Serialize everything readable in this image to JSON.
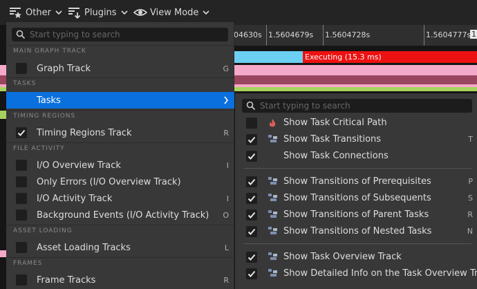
{
  "toolbar": {
    "other_label": "Other",
    "plugins_label": "Plugins",
    "view_mode_label": "View Mode"
  },
  "timeline": {
    "ticks": [
      "04630s",
      "1.5604679s",
      "1.5604728s",
      "1.5604777s",
      "1"
    ],
    "executing_label": "Executing (15.3 ms)"
  },
  "menu": {
    "search_placeholder": "Start typing to search",
    "sections": {
      "main_graph_track": "MAIN GRAPH TRACK",
      "tasks": "TASKS",
      "timing_regions": "TIMING REGIONS",
      "file_activity": "FILE ACTIVITY",
      "asset_loading": "ASSET LOADING",
      "frames": "FRAMES"
    },
    "items": {
      "graph_track": {
        "label": "Graph Track",
        "key": "G",
        "checked": false
      },
      "tasks": {
        "label": "Tasks"
      },
      "timing_regions_track": {
        "label": "Timing Regions Track",
        "key": "R",
        "checked": true
      },
      "io_overview_track": {
        "label": "I/O Overview Track",
        "key": "I",
        "checked": false
      },
      "only_errors": {
        "label": "Only Errors (I/O Overview Track)",
        "key": "",
        "checked": false
      },
      "io_activity_track": {
        "label": "I/O Activity Track",
        "key": "I",
        "checked": false
      },
      "background_events": {
        "label": "Background Events (I/O Activity Track)",
        "key": "O",
        "checked": false
      },
      "asset_loading_tracks": {
        "label": "Asset Loading Tracks",
        "key": "L",
        "checked": false
      },
      "frame_tracks": {
        "label": "Frame Tracks",
        "key": "R",
        "checked": false
      }
    }
  },
  "submenu": {
    "search_placeholder": "Start typing to search",
    "items": [
      {
        "label": "Show Task Critical Path",
        "key": "",
        "checked": false,
        "icon": "flame-icon"
      },
      {
        "label": "Show Task Transitions",
        "key": "T",
        "checked": true,
        "icon": "task-graph-icon"
      },
      {
        "label": "Show Task Connections",
        "key": "",
        "checked": true,
        "icon": "none"
      },
      {
        "label": "Show Transitions of Prerequisites",
        "key": "P",
        "checked": true,
        "icon": "task-graph-icon"
      },
      {
        "label": "Show Transitions of Subsequents",
        "key": "S",
        "checked": true,
        "icon": "task-graph-icon"
      },
      {
        "label": "Show Transitions of Parent Tasks",
        "key": "R",
        "checked": true,
        "icon": "task-graph-icon"
      },
      {
        "label": "Show Transitions of Nested Tasks",
        "key": "N",
        "checked": true,
        "icon": "task-graph-icon"
      },
      {
        "label": "Show Task Overview Track",
        "key": "",
        "checked": true,
        "icon": "task-graph-icon"
      },
      {
        "label": "Show Detailed Info on the Task Overview Track",
        "key": "",
        "checked": true,
        "icon": "task-graph-icon"
      }
    ]
  },
  "colors": {
    "accent_selected": "#0a70dd",
    "executing_bar": "#ee1111",
    "executing_prefix": "#6cd0f2",
    "track_pink": "#f4a9c8",
    "track_mauve": "#9a4560",
    "track_lime": "#a6d35c"
  }
}
